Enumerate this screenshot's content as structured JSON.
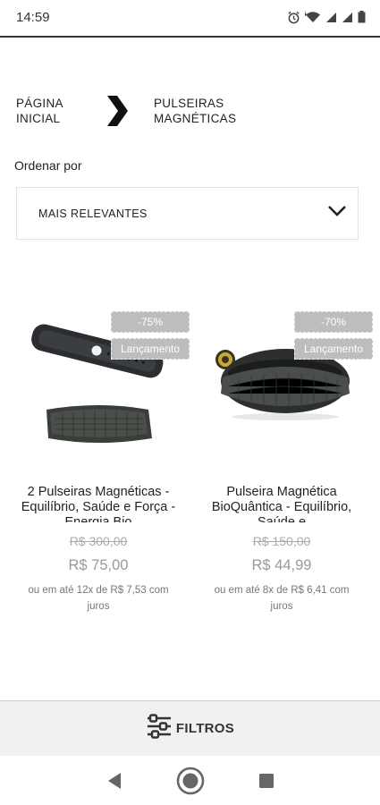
{
  "status_bar": {
    "time": "14:59",
    "icons": [
      "alarm-icon",
      "wifi-icon",
      "signal-icon",
      "signal-icon",
      "battery-icon"
    ]
  },
  "breadcrumb": {
    "home": "PÁGINA INICIAL",
    "separator_icon": "chevron-right-icon",
    "current": "PULSEIRAS MAGNÉTICAS"
  },
  "sort": {
    "label": "Ordenar por",
    "selected": "MAIS RELEVANTES",
    "icon": "chevron-down-icon"
  },
  "products": [
    {
      "discount": "-75%",
      "badge": "Lançamento",
      "name": "2 Pulseiras Magnéticas - Equilíbrio, Saúde e Força - Energia Bio",
      "old_price": "R$ 300,00",
      "price": "R$ 75,00",
      "installments": "ou em até 12x de R$ 7,53 com juros"
    },
    {
      "discount": "-70%",
      "badge": "Lançamento",
      "name": "Pulseira Magnética BioQuântica - Equilíbrio, Saúde e",
      "old_price": "R$ 150,00",
      "price": "R$ 44,99",
      "installments": "ou em até 8x de R$ 6,41 com juros"
    }
  ],
  "filters": {
    "label": "FILTROS",
    "icon": "filter-sliders-icon"
  },
  "nav": {
    "icons": [
      "back-icon",
      "home-icon",
      "recents-icon"
    ]
  },
  "colors": {
    "badge": "#bdbdbd",
    "filters_bar": "#f1f1f1",
    "text": "#222222"
  }
}
